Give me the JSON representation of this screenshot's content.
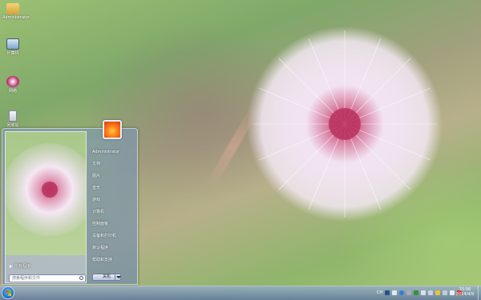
{
  "desktop": {
    "icons": [
      {
        "label": "Administrator",
        "name": "user-folder-icon"
      },
      {
        "label": "计算机",
        "name": "computer-icon"
      },
      {
        "label": "网络",
        "name": "network-icon"
      },
      {
        "label": "回收站",
        "name": "recycle-bin-icon"
      }
    ]
  },
  "start_menu": {
    "user_name": "Administrator",
    "items": [
      "文档",
      "图片",
      "音乐",
      "游戏",
      "计算机",
      "控制面板",
      "设备和打印机",
      "默认程序",
      "帮助和支持"
    ],
    "all_programs": "所有程序",
    "search_placeholder": "搜索程序和文件",
    "shutdown_label": "关机"
  },
  "taskbar": {
    "tray_lang": "CH",
    "time": "15:06",
    "date": "2014/4/9"
  },
  "colors": {
    "accent": "#2a7fd0",
    "taskbar": "#6f8cb4"
  }
}
